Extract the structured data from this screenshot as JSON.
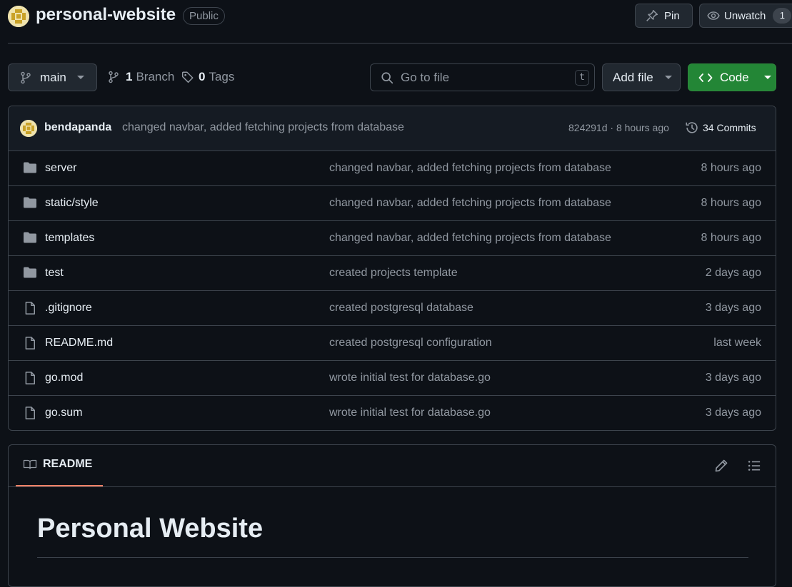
{
  "repo": {
    "name": "personal-website",
    "visibility": "Public",
    "pin_label": "Pin",
    "watch_label": "Unwatch",
    "watch_count": "1"
  },
  "toolbar": {
    "branch": "main",
    "branch_count": "1",
    "branch_label": "Branch",
    "tag_count": "0",
    "tag_label": "Tags",
    "search_placeholder": "Go to file",
    "search_kbd": "t",
    "add_file_label": "Add file",
    "code_label": "Code"
  },
  "latest_commit": {
    "author": "bendapanda",
    "message": "changed navbar, added fetching projects from database",
    "meta": "824291d · 8 hours ago",
    "commits_label": "34 Commits"
  },
  "files": [
    {
      "name": "server",
      "type": "folder",
      "message": "changed navbar, added fetching projects from database",
      "age": "8 hours ago"
    },
    {
      "name": "static/style",
      "type": "folder",
      "message": "changed navbar, added fetching projects from database",
      "age": "8 hours ago"
    },
    {
      "name": "templates",
      "type": "folder",
      "message": "changed navbar, added fetching projects from database",
      "age": "8 hours ago"
    },
    {
      "name": "test",
      "type": "folder",
      "message": "created projects template",
      "age": "2 days ago"
    },
    {
      "name": ".gitignore",
      "type": "file",
      "message": "created postgresql database",
      "age": "3 days ago"
    },
    {
      "name": "README.md",
      "type": "file",
      "message": "created postgresql configuration",
      "age": "last week"
    },
    {
      "name": "go.mod",
      "type": "file",
      "message": "wrote initial test for database.go",
      "age": "3 days ago"
    },
    {
      "name": "go.sum",
      "type": "file",
      "message": "wrote initial test for database.go",
      "age": "3 days ago"
    }
  ],
  "readme": {
    "tab_label": "README",
    "heading": "Personal Website"
  },
  "colors": {
    "background": "#0d1117",
    "border": "#3d444d",
    "accent_green": "#238636",
    "tab_underline": "#f78166"
  }
}
